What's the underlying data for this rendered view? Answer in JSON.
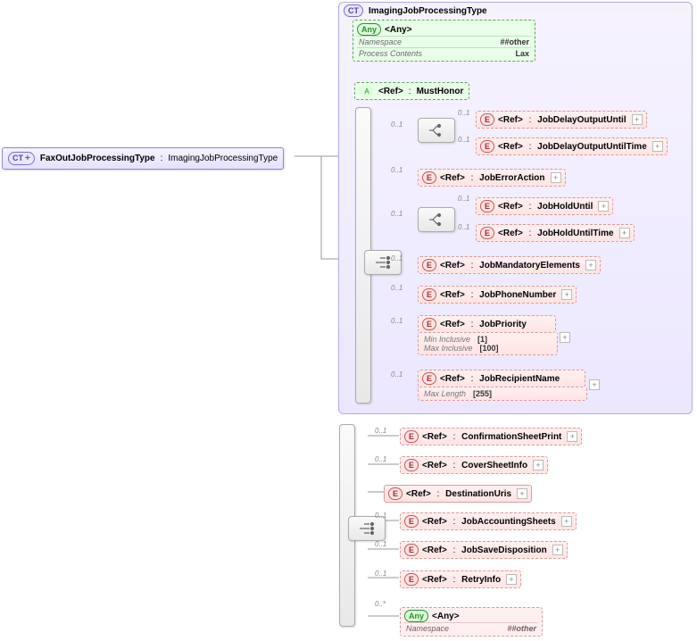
{
  "root": {
    "tag": "CT",
    "name": "FaxOutJobProcessingType",
    "base": "ImagingJobProcessingType"
  },
  "complexType": {
    "tag": "CT",
    "name": "ImagingJobProcessingType"
  },
  "any1": {
    "tag": "Any",
    "label": "<Any>",
    "rows": {
      "ns_k": "Namespace",
      "ns_v": "##other",
      "pc_k": "Process Contents",
      "pc_v": "Lax"
    }
  },
  "attr": {
    "tag": "A",
    "ref": "<Ref>",
    "name": "MustHonor"
  },
  "card": {
    "c01": "0..1",
    "c0n": "0..*"
  },
  "els": {
    "jobDelayOutputUntil": "JobDelayOutputUntil",
    "jobDelayOutputUntilTime": "JobDelayOutputUntilTime",
    "jobErrorAction": "JobErrorAction",
    "jobHoldUntil": "JobHoldUntil",
    "jobHoldUntilTime": "JobHoldUntilTime",
    "jobMandatoryElements": "JobMandatoryElements",
    "jobPhoneNumber": "JobPhoneNumber",
    "jobPriority": "JobPriority",
    "jobRecipientName": "JobRecipientName",
    "confirmationSheetPrint": "ConfirmationSheetPrint",
    "coverSheetInfo": "CoverSheetInfo",
    "destinationUris": "DestinationUris",
    "jobAccountingSheets": "JobAccountingSheets",
    "jobSaveDisposition": "JobSaveDisposition",
    "retryInfo": "RetryInfo",
    "ref": "<Ref>",
    "etag": "E"
  },
  "facets": {
    "minIncl_k": "Min Inclusive",
    "minIncl_v": "[1]",
    "maxIncl_k": "Max Inclusive",
    "maxIncl_v": "[100]",
    "maxLen_k": "Max Length",
    "maxLen_v": "[255]"
  },
  "any2": {
    "tag": "Any",
    "label": "<Any>",
    "ns_k": "Namespace",
    "ns_v": "##other"
  }
}
